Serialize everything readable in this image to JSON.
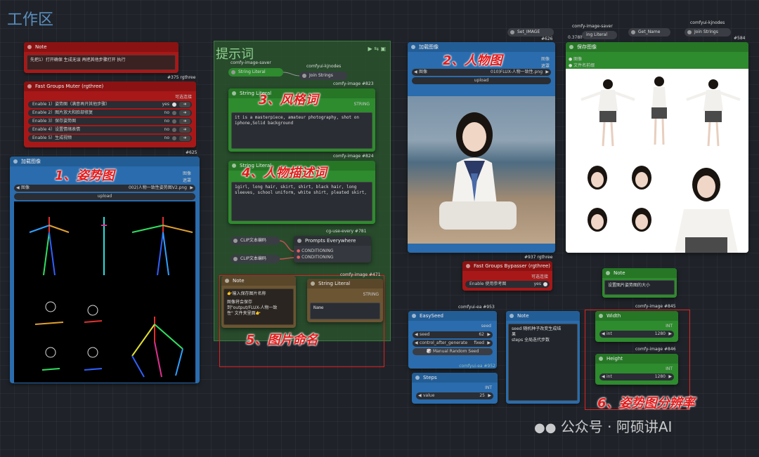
{
  "workspace": {
    "title": "工作区"
  },
  "colors": {
    "red_node": "#a81818",
    "blue_node": "#2a6cad",
    "green_node": "#2e8b2e",
    "group_green": "#2c5a2e",
    "brown_node": "#6b5533",
    "annotation": "#e51b1b"
  },
  "note1": {
    "title": "Note",
    "text": "先把1）打开确保 生成无误 再把其他步骤打开 执行"
  },
  "fast_muter": {
    "id": "#375 rgthree",
    "title": "Fast Groups Muter (rgthree)",
    "hint": "可选连接",
    "rows": [
      {
        "label": "Enable 1）姿势图（满意再开其他步骤）",
        "state": "yes"
      },
      {
        "label": "Enable 2）图片放大和脸部修复",
        "state": "no"
      },
      {
        "label": "Enable 3）保存姿势图",
        "state": "no"
      },
      {
        "label": "Enable 4）设置情绪表情",
        "state": "no"
      },
      {
        "label": "Enable 5）生成视频",
        "state": "no"
      }
    ]
  },
  "pose_node": {
    "id": "#625",
    "title": "加载图像",
    "out1": "图像",
    "out2": "遮罩",
    "image_label": "图像",
    "image_value": "002)人物一致性姿势图V2.png",
    "upload": "upload",
    "annotation": "1、姿势图"
  },
  "group_prompt": {
    "title": "提示词"
  },
  "string_literal_1": {
    "id": "comfy-image-saver",
    "title": "String Literal"
  },
  "join_strings_1": {
    "id": "comfyui-kjnodes",
    "title": "Join Strings"
  },
  "style_node": {
    "id": "comfy-image #823",
    "title": "String Literal",
    "out": "STRING",
    "text": "it is a masterpiece, amateur photography, shot on iphone,Solid background",
    "annotation": "3、风格词"
  },
  "char_node": {
    "id": "comfy-image #824",
    "title": "String Literal",
    "text": "1girl, long hair, skirt, shirt, black hair, long sleeves, school uniform, white shirt, pleated skirt,",
    "annotation": "4、人物描述词"
  },
  "clip": {
    "label1": "CLIP文本编码",
    "label2": "CLIP文本编码"
  },
  "prompts_everywhere": {
    "id": "cg-use-every #781",
    "title": "Prompts Everywhere",
    "in1": "CONDITIONING",
    "in2": "CONDITIONING"
  },
  "note2": {
    "title": "Note",
    "line1": "👉输入保存图片名称",
    "line2": "图像将会保存",
    "line3": "到\"output/FLUX-人物一致",
    "line4": "性\" 文件夹里面👉"
  },
  "naming_node": {
    "id": "comfy-image #471",
    "title": "String Literal",
    "out": "STRING",
    "text": "Name",
    "annotation": "5、图片命名"
  },
  "person_node": {
    "id": "#937 rgthree",
    "title": "加载图像",
    "out1": "图像",
    "out2": "遮罩",
    "image_label": "图像",
    "image_value": "010)FLUX-人物一致性.png",
    "upload": "upload",
    "annotation": "2、人物图"
  },
  "bypasser": {
    "title": "Fast Groups Bypasser (rgthree)",
    "hint": "可选连接",
    "row_label": "Enable 使用参考图",
    "row_state": "yes"
  },
  "set_image": {
    "label": "Set_IMAGE",
    "id": "#626"
  },
  "string_literal_top": {
    "id": "comfy-image-saver",
    "label": "ing Literal",
    "prefix": "0.378lf"
  },
  "get_name": {
    "label": "Get_Name"
  },
  "join_strings_top": {
    "id": "comfyui-kjnodes",
    "label": "Join Strings",
    "node_id": "#584"
  },
  "save_node": {
    "title": "保存图像",
    "in1": "图像",
    "in2": "文件名前缀"
  },
  "easyseed": {
    "id": "comfyui-ea #953",
    "title": "EasySeed",
    "out": "seed",
    "seed_label": "seed",
    "seed_value": "62",
    "control_label": "control_after_generate",
    "control_value": "fixed",
    "button": "🎲 Manual Random Seed",
    "footer": "comfyui-ea #952"
  },
  "note3": {
    "title": "Note",
    "line1": "seed 随机种子改变生成结",
    "line2": "果",
    "line3": "steps 全局迭代步数"
  },
  "steps_node": {
    "title": "Steps",
    "out": "INT",
    "label": "value",
    "value": "25"
  },
  "note4": {
    "title": "Note",
    "text": "设置图片姿势图的大小"
  },
  "width_node": {
    "id": "comfy-image #845",
    "title": "Width",
    "out": "INT",
    "label": "int",
    "value": "1280"
  },
  "height_node": {
    "id": "comfy-image #846",
    "title": "Height",
    "out": "INT",
    "label": "int",
    "value": "1280"
  },
  "res_annotation": "6、姿势图分辨率",
  "watermark": "公众号 · 阿硕讲AI"
}
